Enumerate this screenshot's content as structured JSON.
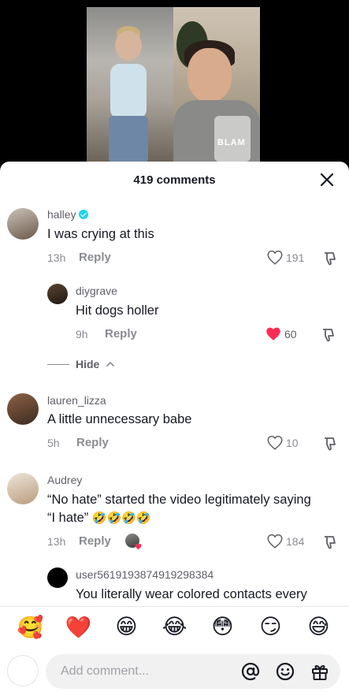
{
  "video": {
    "cup_text": "BLAM"
  },
  "header": {
    "comments_count": "419 comments"
  },
  "comments": [
    {
      "username": "halley",
      "verified": true,
      "text": "I was crying at this",
      "time": "13h",
      "reply": "Reply",
      "likes": "191"
    },
    {
      "username": "diygrave",
      "text": "Hit dogs holler",
      "time": "9h",
      "reply": "Reply",
      "likes": "60",
      "liked": true
    },
    {
      "username": "lauren_lizza",
      "text": "A little unnecessary babe",
      "time": "5h",
      "reply": "Reply",
      "likes": "10"
    },
    {
      "username": "Audrey",
      "text": "“No hate” started the video legitimately saying “I hate”",
      "text_emoji": "🤣🤣🤣🤣",
      "time": "13h",
      "reply": "Reply",
      "likes": "184"
    },
    {
      "username": "user5619193874919298384",
      "text": "You literally wear colored contacts every"
    }
  ],
  "hide_label": "Hide",
  "emoji_bar": [
    "🥰",
    "❤️",
    "😁",
    "😂",
    "😳",
    "😏",
    "😅"
  ],
  "input": {
    "placeholder": "Add comment..."
  },
  "colors": {
    "like_red": "#fe2c55",
    "verified": "#20d5ec"
  }
}
